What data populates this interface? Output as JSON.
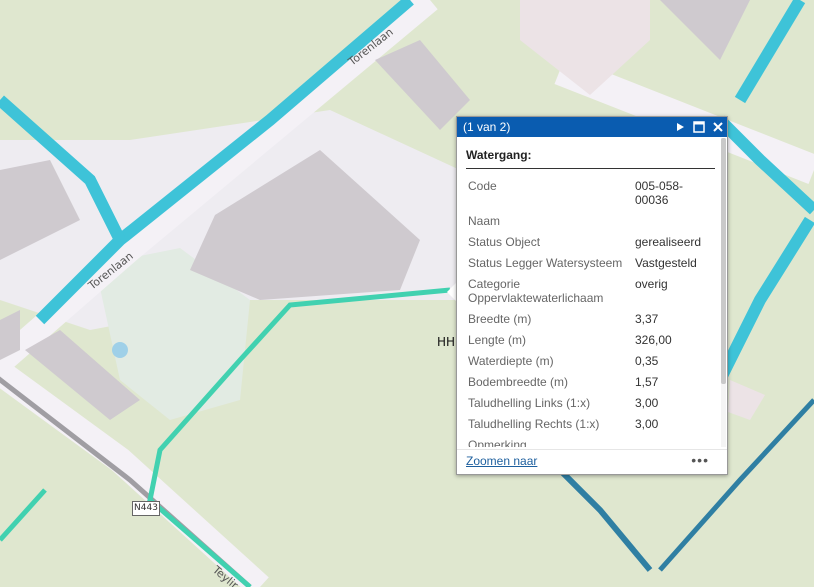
{
  "map": {
    "roads": {
      "torenlaan_top": "Torenlaan",
      "torenlaan_mid": "Torenlaan",
      "teylingerlaan": "Teylir"
    },
    "shield": "N443",
    "feature_label": "HH",
    "colors": {
      "background": "#dfe7cf",
      "water": "#3ec3d8",
      "road": "#f4f1f6",
      "building": "#cfcacf",
      "railway": "#a09ea3"
    }
  },
  "popup": {
    "title": "(1 van 2)",
    "controls": {
      "next_icon": "play-icon",
      "maximize_icon": "maximize-icon",
      "close_icon": "close-icon"
    },
    "heading": "Watergang:",
    "rows": [
      {
        "label": "Code",
        "value": "005-058-00036"
      },
      {
        "label": "Naam",
        "value": ""
      },
      {
        "label": "Status Object",
        "value": "gerealiseerd"
      },
      {
        "label": "Status Legger Watersysteem",
        "value": "Vastgesteld"
      },
      {
        "label": "Categorie Oppervlaktewaterlichaam",
        "value": "overig"
      },
      {
        "label": "Breedte (m)",
        "value": "3,37"
      },
      {
        "label": "Lengte (m)",
        "value": "326,00"
      },
      {
        "label": "Waterdiepte (m)",
        "value": "0,35"
      },
      {
        "label": "Bodembreedte (m)",
        "value": "1,57"
      },
      {
        "label": "Taludhelling Links (1:x)",
        "value": "3,00"
      },
      {
        "label": "Taludhelling Rechts (1:x)",
        "value": "3,00"
      },
      {
        "label": "Opmerking",
        "value": ""
      }
    ],
    "zoom_link": "Zoomen naar",
    "more_icon": "ellipsis-icon",
    "more_text": "•••",
    "title_color": "#0a5cb0"
  }
}
